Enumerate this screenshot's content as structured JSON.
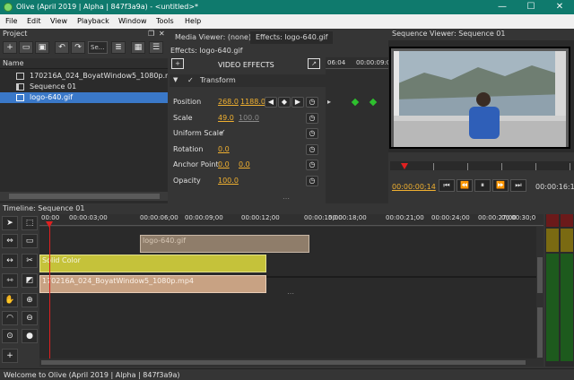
{
  "window": {
    "title": "Olive (April 2019 | Alpha | 847f3a9a) - <untitled>*",
    "minimize": "—",
    "maximize": "☐",
    "close": "✕"
  },
  "menu": [
    "File",
    "Edit",
    "View",
    "Playback",
    "Window",
    "Tools",
    "Help"
  ],
  "project": {
    "title": "Project",
    "search_placeholder": "Se...",
    "column_name": "Name",
    "items": [
      {
        "label": "170216A_024_BoyatWindow5_1080p.mp4",
        "selected": false
      },
      {
        "label": "Sequence 01",
        "selected": false
      },
      {
        "label": "logo-640.gif",
        "selected": true
      }
    ]
  },
  "effects": {
    "tab_media_viewer": "Media Viewer: (none)",
    "tab_effects": "Effects: logo-640.gif",
    "header": "Effects: logo-640.gif",
    "section_title": "VIDEO EFFECTS",
    "group": "Transform",
    "ruler": [
      "06:04",
      "00:00:09:0"
    ],
    "params": {
      "position_label": "Position",
      "position_x": "268.0",
      "position_y": "1188.0",
      "scale_label": "Scale",
      "scale_value": "49.0",
      "scale_value2": "100.0",
      "uniform_label": "Uniform Scale",
      "rotation_label": "Rotation",
      "rotation_value": "0.0",
      "anchor_label": "Anchor Point",
      "anchor_x": "0.0",
      "anchor_y": "0.0",
      "opacity_label": "Opacity",
      "opacity_value": "100.0"
    }
  },
  "viewer": {
    "title": "Sequence Viewer: Sequence 01",
    "current_time": "00:00:00;14",
    "end_time": "00:00:16:16"
  },
  "timeline": {
    "title": "Timeline: Sequence 01",
    "ticks": [
      "00:00",
      "00:00:03;00",
      "00:00:06;00",
      "00:00:09;00",
      "00:00:12;00",
      "00:00:15;00",
      "00:00:18;00",
      "00:00:21;00",
      "00:00:24;00",
      "00:00:27;00",
      "00:00:30;0"
    ],
    "clips": {
      "logo": "logo-640.gif",
      "solid": "Solid Color",
      "video": "170216A_024_BoyatWindow5_1080p.mp4"
    }
  },
  "status": "Welcome to Olive (April 2019 | Alpha | 847f3a9a)",
  "colors": {
    "accent": "#0f7a6d",
    "selection": "#3a78c8",
    "value": "#f0b030",
    "playhead": "#e02020",
    "keyframe": "#2ec02e",
    "clip_logo": "#8f7d6a",
    "clip_solid": "#c5c23a",
    "clip_video": "#c8a283"
  }
}
